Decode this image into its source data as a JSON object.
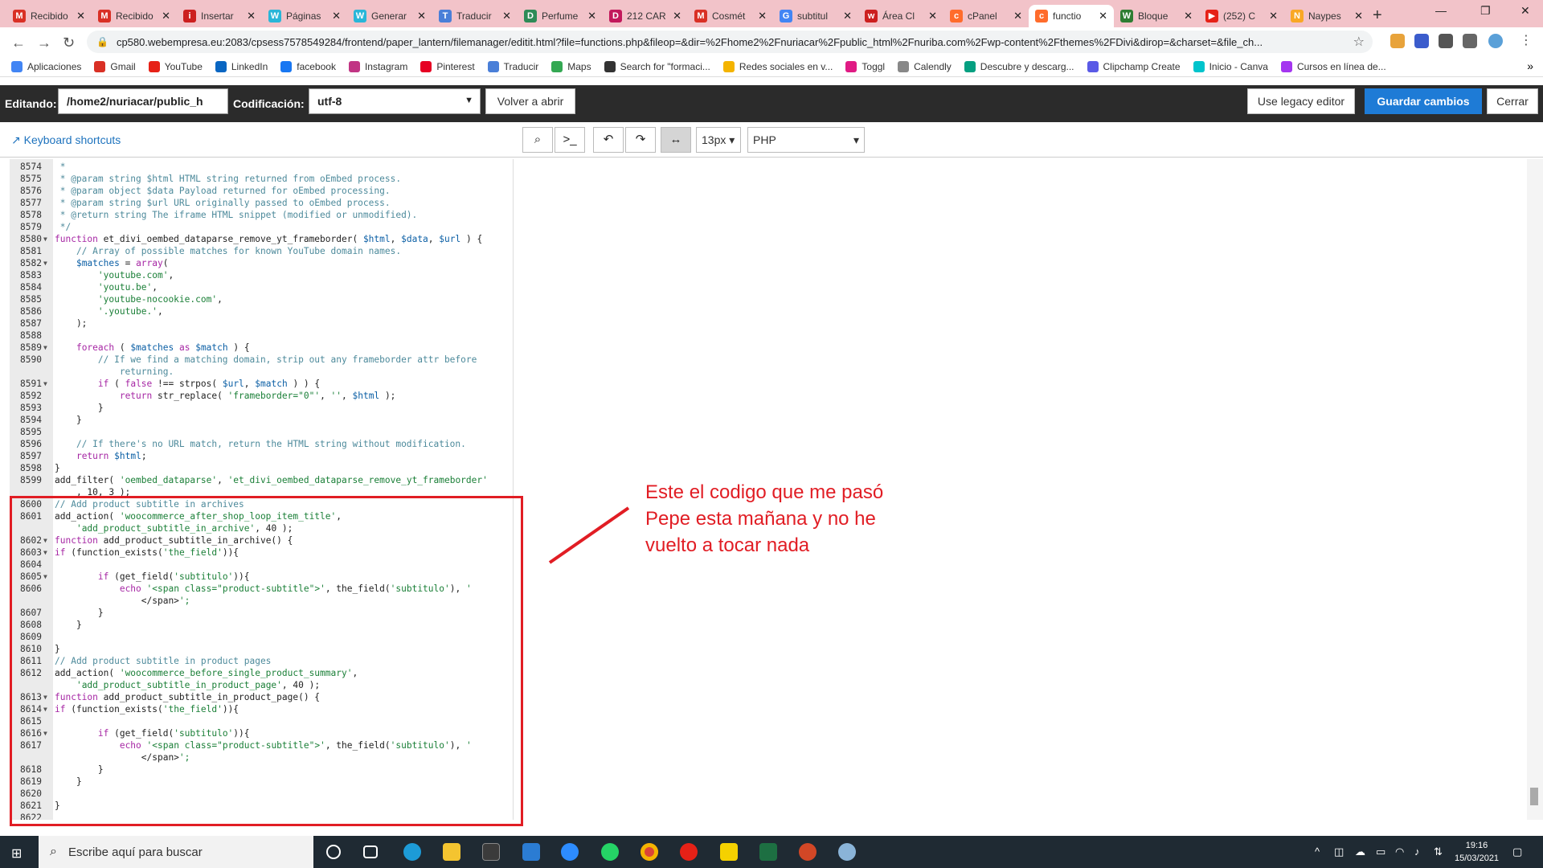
{
  "browser": {
    "tabs": [
      {
        "label": "Recibido",
        "color": "#d93025",
        "glyph": "M"
      },
      {
        "label": "Recibido",
        "color": "#d93025",
        "glyph": "M"
      },
      {
        "label": "Insertar",
        "color": "#cc1f1f",
        "glyph": "i"
      },
      {
        "label": "Páginas",
        "color": "#29b6d8",
        "glyph": "W"
      },
      {
        "label": "Generar",
        "color": "#29b6d8",
        "glyph": "W"
      },
      {
        "label": "Traducir",
        "color": "#4a7fd8",
        "glyph": "T"
      },
      {
        "label": "Perfume",
        "color": "#2e8b57",
        "glyph": "D"
      },
      {
        "label": "212 CAR",
        "color": "#c2185b",
        "glyph": "D"
      },
      {
        "label": "Cosmét",
        "color": "#d93025",
        "glyph": "M"
      },
      {
        "label": "subtitul",
        "color": "#4285f4",
        "glyph": "G"
      },
      {
        "label": "Área Cl",
        "color": "#cc1f1f",
        "glyph": "w"
      },
      {
        "label": "cPanel",
        "color": "#ff6c2c",
        "glyph": "c"
      },
      {
        "label": "functio",
        "color": "#ff6c2c",
        "glyph": "c"
      },
      {
        "label": "Bloque",
        "color": "#2e7d32",
        "glyph": "W"
      },
      {
        "label": "(252) C",
        "color": "#e62117",
        "glyph": "▶"
      },
      {
        "label": "Naypes",
        "color": "#f9a825",
        "glyph": "N"
      }
    ],
    "active_tab_index": 12,
    "url": "cp580.webempresa.eu:2083/cpsess7578549284/frontend/paper_lantern/filemanager/editit.html?file=functions.php&fileop=&dir=%2Fhome2%2Fnuriacar%2Fpublic_html%2Fnuriba.com%2Fwp-content%2Fthemes%2FDivi&dirop=&charset=&file_ch...",
    "bookmarks": [
      {
        "label": "Aplicaciones",
        "color": "#4285f4"
      },
      {
        "label": "Gmail",
        "color": "#d93025"
      },
      {
        "label": "YouTube",
        "color": "#e62117"
      },
      {
        "label": "LinkedIn",
        "color": "#0a66c2"
      },
      {
        "label": "facebook",
        "color": "#1877f2"
      },
      {
        "label": "Instagram",
        "color": "#c13584"
      },
      {
        "label": "Pinterest",
        "color": "#e60023"
      },
      {
        "label": "Traducir",
        "color": "#4a7fd8"
      },
      {
        "label": "Maps",
        "color": "#34a853"
      },
      {
        "label": "Search for \"formaci...",
        "color": "#333333"
      },
      {
        "label": "Redes sociales en v...",
        "color": "#f4b400"
      },
      {
        "label": "Toggl",
        "color": "#e01b84"
      },
      {
        "label": "Calendly",
        "color": "#888888"
      },
      {
        "label": "Descubre y descarg...",
        "color": "#05a081"
      },
      {
        "label": "Clipchamp Create",
        "color": "#5a5ae6"
      },
      {
        "label": "Inicio - Canva",
        "color": "#00c4cc"
      },
      {
        "label": "Cursos en línea de...",
        "color": "#a435f0"
      }
    ]
  },
  "editor_header": {
    "editing_label": "Editando:",
    "path_value": "/home2/nuriacar/public_h",
    "encoding_label": "Codificación:",
    "encoding_value": "utf-8",
    "reopen_button": "Volver a abrir",
    "legacy_button": "Use legacy editor",
    "save_button": "Guardar cambios",
    "close_button": "Cerrar"
  },
  "editor_toolbar": {
    "shortcuts_label": "Keyboard shortcuts",
    "font_size": "13px",
    "mode": "PHP"
  },
  "code_lines": [
    {
      "n": "8574",
      "fold": false,
      "t": " *"
    },
    {
      "n": "8575",
      "fold": false,
      "t": " * @param string $html HTML string returned from oEmbed process."
    },
    {
      "n": "8576",
      "fold": false,
      "t": " * @param object $data Payload returned for oEmbed processing."
    },
    {
      "n": "8577",
      "fold": false,
      "t": " * @param string $url URL originally passed to oEmbed process."
    },
    {
      "n": "8578",
      "fold": false,
      "t": " * @return string The iframe HTML snippet (modified or unmodified)."
    },
    {
      "n": "8579",
      "fold": false,
      "t": " */"
    },
    {
      "n": "8580",
      "fold": true,
      "t": "function et_divi_oembed_dataparse_remove_yt_frameborder( $html, $data, $url ) {"
    },
    {
      "n": "8581",
      "fold": false,
      "t": "    // Array of possible matches for known YouTube domain names."
    },
    {
      "n": "8582",
      "fold": true,
      "t": "    $matches = array("
    },
    {
      "n": "8583",
      "fold": false,
      "t": "        'youtube.com',"
    },
    {
      "n": "8584",
      "fold": false,
      "t": "        'youtu.be',"
    },
    {
      "n": "8585",
      "fold": false,
      "t": "        'youtube-nocookie.com',"
    },
    {
      "n": "8586",
      "fold": false,
      "t": "        '.youtube.',"
    },
    {
      "n": "8587",
      "fold": false,
      "t": "    );"
    },
    {
      "n": "8588",
      "fold": false,
      "t": ""
    },
    {
      "n": "8589",
      "fold": true,
      "t": "    foreach ( $matches as $match ) {"
    },
    {
      "n": "8590",
      "fold": false,
      "t": "        // If we find a matching domain, strip out any frameborder attr before"
    },
    {
      "n": "",
      "fold": false,
      "t": "            returning."
    },
    {
      "n": "8591",
      "fold": true,
      "t": "        if ( false !== strpos( $url, $match ) ) {"
    },
    {
      "n": "8592",
      "fold": false,
      "t": "            return str_replace( 'frameborder=\"0\"', '', $html );"
    },
    {
      "n": "8593",
      "fold": false,
      "t": "        }"
    },
    {
      "n": "8594",
      "fold": false,
      "t": "    }"
    },
    {
      "n": "8595",
      "fold": false,
      "t": ""
    },
    {
      "n": "8596",
      "fold": false,
      "t": "    // If there's no URL match, return the HTML string without modification."
    },
    {
      "n": "8597",
      "fold": false,
      "t": "    return $html;"
    },
    {
      "n": "8598",
      "fold": false,
      "t": "}"
    },
    {
      "n": "8599",
      "fold": false,
      "t": "add_filter( 'oembed_dataparse', 'et_divi_oembed_dataparse_remove_yt_frameborder'"
    },
    {
      "n": "",
      "fold": false,
      "t": "    , 10, 3 );"
    },
    {
      "n": "8600",
      "fold": false,
      "t": "// Add product subtitle in archives"
    },
    {
      "n": "8601",
      "fold": false,
      "t": "add_action( 'woocommerce_after_shop_loop_item_title',"
    },
    {
      "n": "",
      "fold": false,
      "t": "    'add_product_subtitle_in_archive', 40 );"
    },
    {
      "n": "8602",
      "fold": true,
      "t": "function add_product_subtitle_in_archive() {"
    },
    {
      "n": "8603",
      "fold": true,
      "t": "if (function_exists('the_field')){"
    },
    {
      "n": "8604",
      "fold": false,
      "t": ""
    },
    {
      "n": "8605",
      "fold": true,
      "t": "        if (get_field('subtitulo')){"
    },
    {
      "n": "8606",
      "fold": false,
      "t": "            echo '<span class=\"product-subtitle\">', the_field('subtitulo'), '"
    },
    {
      "n": "",
      "fold": false,
      "t": "                </span>';"
    },
    {
      "n": "8607",
      "fold": false,
      "t": "        }"
    },
    {
      "n": "8608",
      "fold": false,
      "t": "    }"
    },
    {
      "n": "8609",
      "fold": false,
      "t": ""
    },
    {
      "n": "8610",
      "fold": false,
      "t": "}"
    },
    {
      "n": "8611",
      "fold": false,
      "t": "// Add product subtitle in product pages"
    },
    {
      "n": "8612",
      "fold": false,
      "t": "add_action( 'woocommerce_before_single_product_summary',"
    },
    {
      "n": "",
      "fold": false,
      "t": "    'add_product_subtitle_in_product_page', 40 );"
    },
    {
      "n": "8613",
      "fold": true,
      "t": "function add_product_subtitle_in_product_page() {"
    },
    {
      "n": "8614",
      "fold": true,
      "t": "if (function_exists('the_field')){"
    },
    {
      "n": "8615",
      "fold": false,
      "t": ""
    },
    {
      "n": "8616",
      "fold": true,
      "t": "        if (get_field('subtitulo')){"
    },
    {
      "n": "8617",
      "fold": false,
      "t": "            echo '<span class=\"product-subtitle\">', the_field('subtitulo'), '"
    },
    {
      "n": "",
      "fold": false,
      "t": "                </span>';"
    },
    {
      "n": "8618",
      "fold": false,
      "t": "        }"
    },
    {
      "n": "8619",
      "fold": false,
      "t": "    }"
    },
    {
      "n": "8620",
      "fold": false,
      "t": ""
    },
    {
      "n": "8621",
      "fold": false,
      "t": "}"
    },
    {
      "n": "8622",
      "fold": false,
      "t": ""
    }
  ],
  "annotation": {
    "note": "Este el codigo que me pasó Pepe esta mañana y no he vuelto a tocar nada",
    "color": "#e11d24"
  },
  "taskbar": {
    "search_placeholder": "Escribe aquí para buscar",
    "time": "19:16",
    "date": "15/03/2021"
  }
}
